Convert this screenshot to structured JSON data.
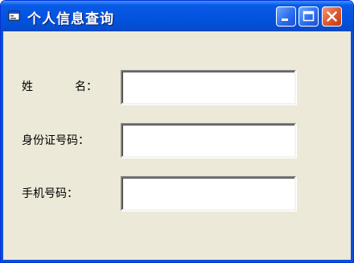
{
  "window": {
    "title": "个人信息查询"
  },
  "titlebar": {
    "app_icon": "form-window-icon",
    "buttons": [
      {
        "name": "minimize",
        "icon": "minimize-icon"
      },
      {
        "name": "maximize",
        "icon": "maximize-icon"
      },
      {
        "name": "close",
        "icon": "close-icon"
      }
    ]
  },
  "form": {
    "name_label_first": "姓",
    "name_label_second": "名：",
    "name_value": "",
    "id_label": "身份证号码：",
    "id_value": "",
    "phone_label": "手机号码：",
    "phone_value": ""
  },
  "colors": {
    "titlebar": "#0454e0",
    "client_background": "#ece9d8",
    "close_button": "#e05a30"
  }
}
